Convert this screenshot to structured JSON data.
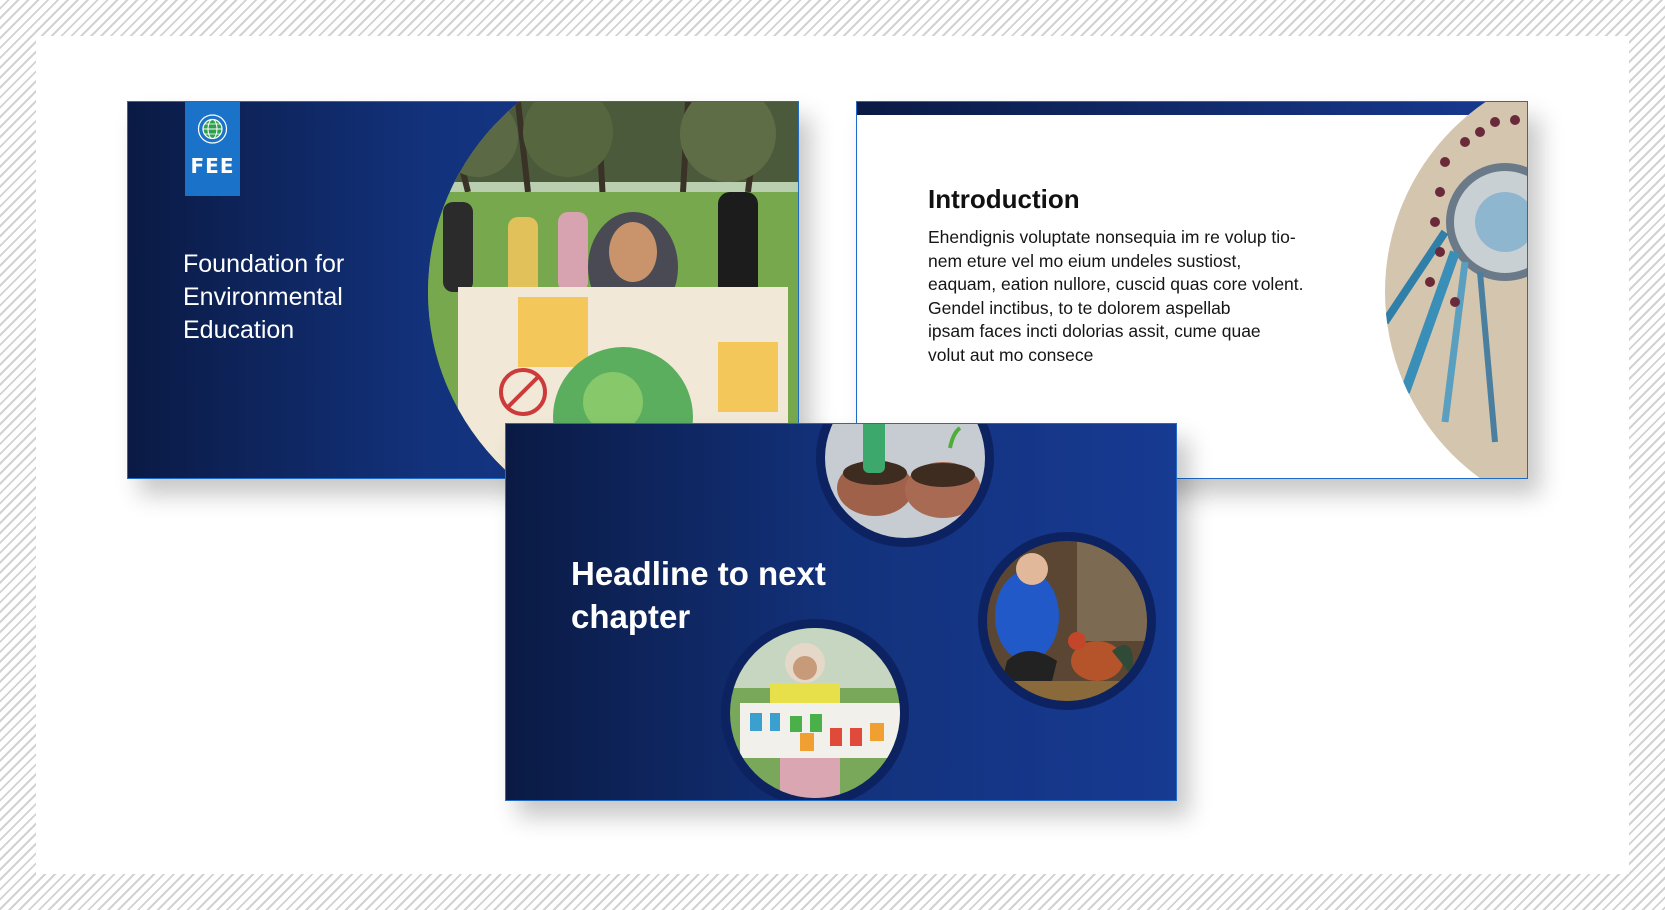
{
  "slides": {
    "cover": {
      "logo_text": "FEE",
      "title": "Foundation for Environmental Education"
    },
    "introduction": {
      "heading": "Introduction",
      "body": "Ehendignis voluptate nonsequia im re volup tio-\nnem eture vel mo eium undeles sustiost,\neaquam, eation nullore, cuscid quas core volent.\nGendel inctibus, to te dolorem aspellab\nipsam faces incti dolorias assit, cume quae\nvolut aut mo consece"
    },
    "chapter": {
      "headline": "Headline to next chapter"
    }
  },
  "colors": {
    "navy_dark": "#0a1a44",
    "navy": "#173a92",
    "logo_blue": "#1a73c8",
    "border_blue": "#1f6bc7"
  },
  "images": {
    "cover_photo": "child-holding-earth-poster-photo",
    "intro_photo": "aerial-sun-artwork-photo",
    "chapter_photos": [
      "hands-holding-soil-photo",
      "child-feeding-rooster-photo",
      "litter-banner-photo"
    ]
  }
}
